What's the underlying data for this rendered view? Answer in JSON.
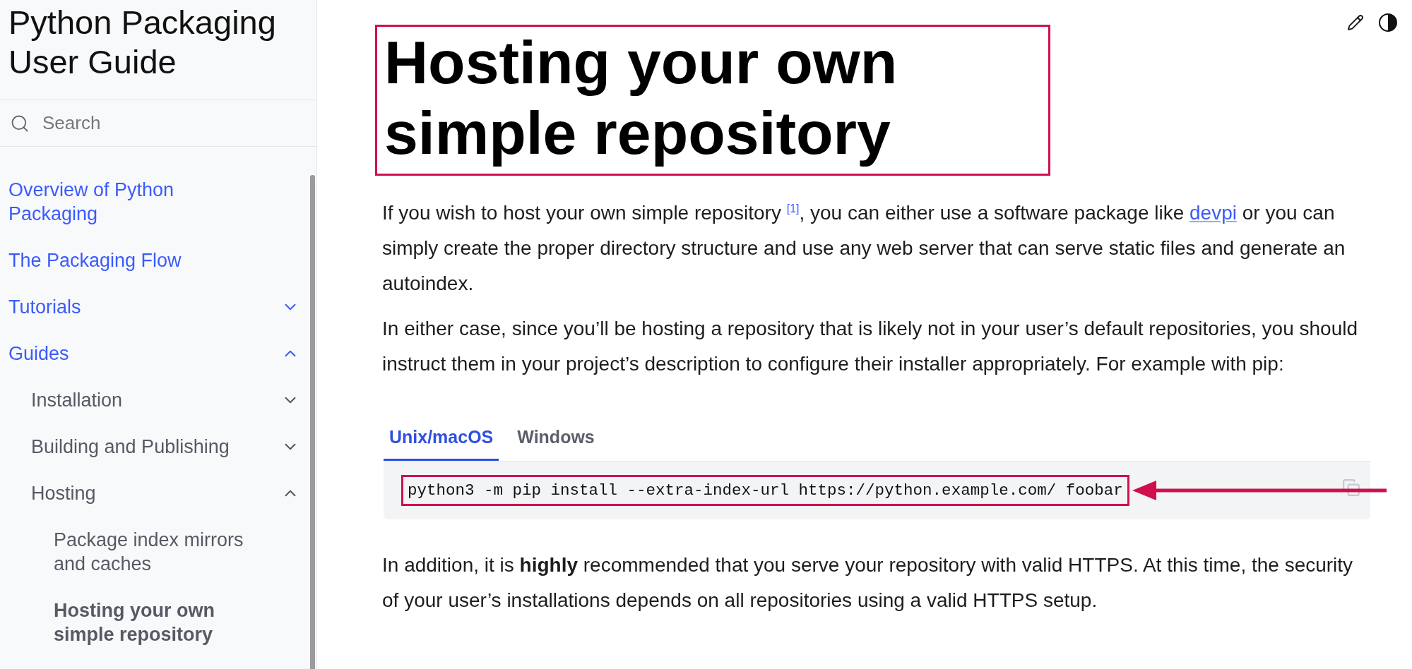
{
  "sidebar": {
    "title": "Python Packaging User Guide",
    "search": {
      "placeholder": "Search"
    },
    "nav": [
      {
        "label": "Overview of Python Packaging",
        "selected": false
      },
      {
        "label": "The Packaging Flow",
        "selected": false
      },
      {
        "label": "Tutorials",
        "selected": false,
        "expanded": false
      },
      {
        "label": "Guides",
        "selected": false,
        "expanded": true,
        "children": [
          {
            "label": "Installation",
            "selected": false,
            "expanded": false
          },
          {
            "label": "Building and Publishing",
            "selected": false,
            "expanded": false
          },
          {
            "label": "Hosting",
            "selected": false,
            "expanded": true,
            "children": [
              {
                "label": "Package index mirrors and caches",
                "selected": false
              },
              {
                "label": "Hosting your own simple repository",
                "selected": true
              }
            ]
          }
        ]
      }
    ]
  },
  "article": {
    "title": "Hosting your own simple repository",
    "paragraphs": [
      {
        "parts": [
          {
            "kind": "text",
            "text": "If you wish to host your own simple repository "
          },
          {
            "kind": "footnote",
            "text": "[1]"
          },
          {
            "kind": "text",
            "text": ", you can either use a software package like "
          },
          {
            "kind": "link",
            "text": "devpi"
          },
          {
            "kind": "text",
            "text": " or you can simply create the proper directory structure and use any web server that can serve static files and generate an autoindex."
          }
        ]
      },
      {
        "parts": [
          {
            "kind": "text",
            "text": "In either case, since you’ll be hosting a repository that is likely not in your user’s default repositories, you should instruct them in your project’s description to configure their installer appropriately. For example with pip:"
          }
        ]
      }
    ],
    "tabs": [
      {
        "label": "Unix/macOS",
        "selected": true
      },
      {
        "label": "Windows",
        "selected": false
      }
    ],
    "code": "python3 -m pip install --extra-index-url https://python.example.com/ foobar",
    "after": "In addition, it is **highly** recommended that you serve your repository with valid HTTPS. At this time, the security of your user’s installations depends on all repositories using a valid HTTPS setup."
  }
}
